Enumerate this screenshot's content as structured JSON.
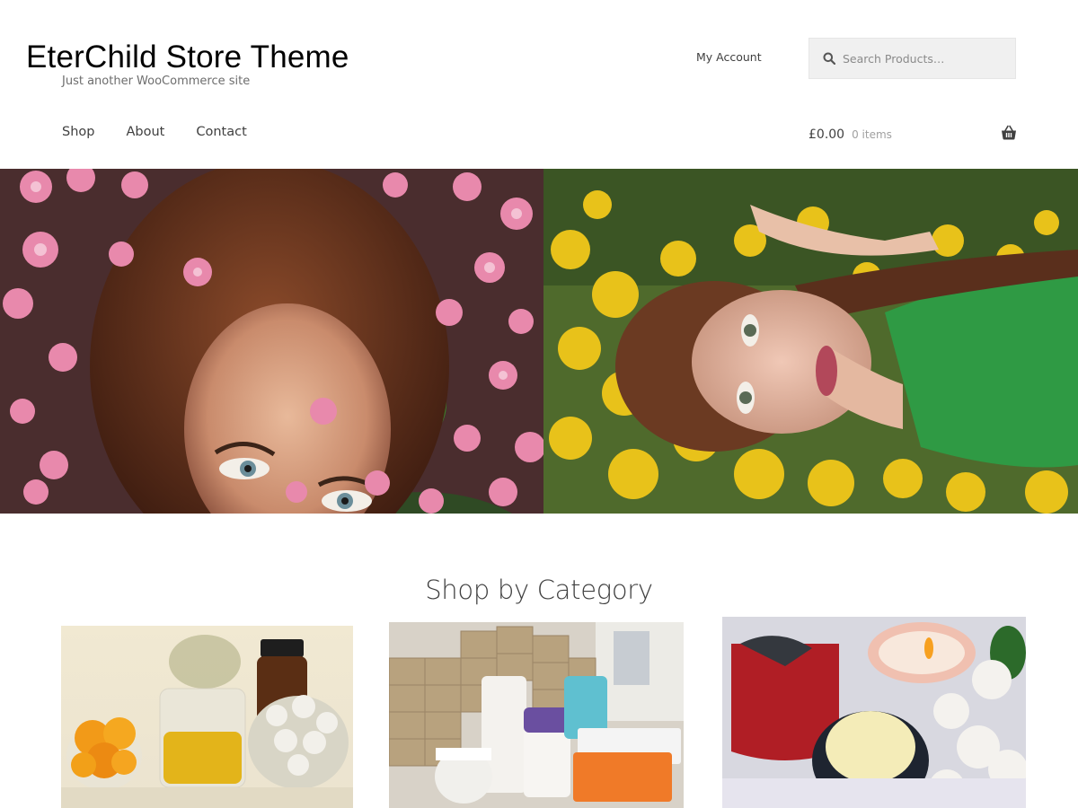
{
  "header": {
    "site_title": "EterChild Store Theme",
    "tagline": "Just another WooCommerce site",
    "my_account": "My Account",
    "search": {
      "placeholder": "Search Products…"
    }
  },
  "nav": {
    "items": [
      {
        "label": "Shop"
      },
      {
        "label": "About"
      },
      {
        "label": "Contact"
      }
    ]
  },
  "cart": {
    "amount": "£0.00",
    "count": "0 items",
    "icon": "basket-icon"
  },
  "hero": {
    "left_image": "woman-with-pink-flowers",
    "right_image": "woman-lying-in-yellow-flowers"
  },
  "section": {
    "title": "Shop by Category"
  },
  "categories": [
    {
      "image": "herbal-ingredients-beakers"
    },
    {
      "image": "skincare-products-warehouse"
    },
    {
      "image": "spa-candle-cream-flowers"
    }
  ],
  "colors": {
    "text": "#404040",
    "title": "#000000",
    "search_bg": "#f0f0f0"
  }
}
